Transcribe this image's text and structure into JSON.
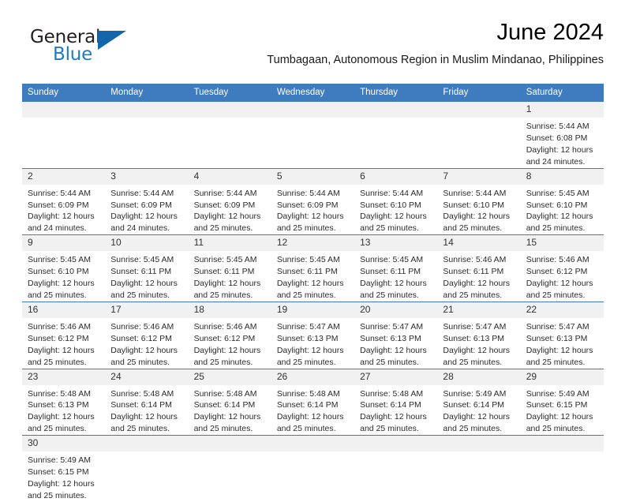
{
  "brand": {
    "name_part1": "General",
    "name_part2": "Blue",
    "primary_color": "#1466ab",
    "accent_color": "#1b7bc4"
  },
  "header": {
    "month_title": "June 2024",
    "location": "Tumbagaan, Autonomous Region in Muslim Mindanao, Philippines",
    "header_bg_color": "#3f7cbf"
  },
  "weekdays": [
    "Sunday",
    "Monday",
    "Tuesday",
    "Wednesday",
    "Thursday",
    "Friday",
    "Saturday"
  ],
  "labels": {
    "sunrise": "Sunrise:",
    "sunset": "Sunset:",
    "daylight": "Daylight:"
  },
  "weeks": [
    [
      {
        "day": "",
        "sunrise": "",
        "sunset": "",
        "daylight_line1": "",
        "daylight_line2": "",
        "blank": true
      },
      {
        "day": "",
        "sunrise": "",
        "sunset": "",
        "daylight_line1": "",
        "daylight_line2": "",
        "blank": true
      },
      {
        "day": "",
        "sunrise": "",
        "sunset": "",
        "daylight_line1": "",
        "daylight_line2": "",
        "blank": true
      },
      {
        "day": "",
        "sunrise": "",
        "sunset": "",
        "daylight_line1": "",
        "daylight_line2": "",
        "blank": true
      },
      {
        "day": "",
        "sunrise": "",
        "sunset": "",
        "daylight_line1": "",
        "daylight_line2": "",
        "blank": true
      },
      {
        "day": "",
        "sunrise": "",
        "sunset": "",
        "daylight_line1": "",
        "daylight_line2": "",
        "blank": true
      },
      {
        "day": "1",
        "sunrise": "Sunrise: 5:44 AM",
        "sunset": "Sunset: 6:08 PM",
        "daylight_line1": "Daylight: 12 hours",
        "daylight_line2": "and 24 minutes.",
        "blank": false
      }
    ],
    [
      {
        "day": "2",
        "sunrise": "Sunrise: 5:44 AM",
        "sunset": "Sunset: 6:09 PM",
        "daylight_line1": "Daylight: 12 hours",
        "daylight_line2": "and 24 minutes.",
        "blank": false
      },
      {
        "day": "3",
        "sunrise": "Sunrise: 5:44 AM",
        "sunset": "Sunset: 6:09 PM",
        "daylight_line1": "Daylight: 12 hours",
        "daylight_line2": "and 24 minutes.",
        "blank": false
      },
      {
        "day": "4",
        "sunrise": "Sunrise: 5:44 AM",
        "sunset": "Sunset: 6:09 PM",
        "daylight_line1": "Daylight: 12 hours",
        "daylight_line2": "and 25 minutes.",
        "blank": false
      },
      {
        "day": "5",
        "sunrise": "Sunrise: 5:44 AM",
        "sunset": "Sunset: 6:09 PM",
        "daylight_line1": "Daylight: 12 hours",
        "daylight_line2": "and 25 minutes.",
        "blank": false
      },
      {
        "day": "6",
        "sunrise": "Sunrise: 5:44 AM",
        "sunset": "Sunset: 6:10 PM",
        "daylight_line1": "Daylight: 12 hours",
        "daylight_line2": "and 25 minutes.",
        "blank": false
      },
      {
        "day": "7",
        "sunrise": "Sunrise: 5:44 AM",
        "sunset": "Sunset: 6:10 PM",
        "daylight_line1": "Daylight: 12 hours",
        "daylight_line2": "and 25 minutes.",
        "blank": false
      },
      {
        "day": "8",
        "sunrise": "Sunrise: 5:45 AM",
        "sunset": "Sunset: 6:10 PM",
        "daylight_line1": "Daylight: 12 hours",
        "daylight_line2": "and 25 minutes.",
        "blank": false
      }
    ],
    [
      {
        "day": "9",
        "sunrise": "Sunrise: 5:45 AM",
        "sunset": "Sunset: 6:10 PM",
        "daylight_line1": "Daylight: 12 hours",
        "daylight_line2": "and 25 minutes.",
        "blank": false
      },
      {
        "day": "10",
        "sunrise": "Sunrise: 5:45 AM",
        "sunset": "Sunset: 6:11 PM",
        "daylight_line1": "Daylight: 12 hours",
        "daylight_line2": "and 25 minutes.",
        "blank": false
      },
      {
        "day": "11",
        "sunrise": "Sunrise: 5:45 AM",
        "sunset": "Sunset: 6:11 PM",
        "daylight_line1": "Daylight: 12 hours",
        "daylight_line2": "and 25 minutes.",
        "blank": false
      },
      {
        "day": "12",
        "sunrise": "Sunrise: 5:45 AM",
        "sunset": "Sunset: 6:11 PM",
        "daylight_line1": "Daylight: 12 hours",
        "daylight_line2": "and 25 minutes.",
        "blank": false
      },
      {
        "day": "13",
        "sunrise": "Sunrise: 5:45 AM",
        "sunset": "Sunset: 6:11 PM",
        "daylight_line1": "Daylight: 12 hours",
        "daylight_line2": "and 25 minutes.",
        "blank": false
      },
      {
        "day": "14",
        "sunrise": "Sunrise: 5:46 AM",
        "sunset": "Sunset: 6:11 PM",
        "daylight_line1": "Daylight: 12 hours",
        "daylight_line2": "and 25 minutes.",
        "blank": false
      },
      {
        "day": "15",
        "sunrise": "Sunrise: 5:46 AM",
        "sunset": "Sunset: 6:12 PM",
        "daylight_line1": "Daylight: 12 hours",
        "daylight_line2": "and 25 minutes.",
        "blank": false
      }
    ],
    [
      {
        "day": "16",
        "sunrise": "Sunrise: 5:46 AM",
        "sunset": "Sunset: 6:12 PM",
        "daylight_line1": "Daylight: 12 hours",
        "daylight_line2": "and 25 minutes.",
        "blank": false
      },
      {
        "day": "17",
        "sunrise": "Sunrise: 5:46 AM",
        "sunset": "Sunset: 6:12 PM",
        "daylight_line1": "Daylight: 12 hours",
        "daylight_line2": "and 25 minutes.",
        "blank": false
      },
      {
        "day": "18",
        "sunrise": "Sunrise: 5:46 AM",
        "sunset": "Sunset: 6:12 PM",
        "daylight_line1": "Daylight: 12 hours",
        "daylight_line2": "and 25 minutes.",
        "blank": false
      },
      {
        "day": "19",
        "sunrise": "Sunrise: 5:47 AM",
        "sunset": "Sunset: 6:13 PM",
        "daylight_line1": "Daylight: 12 hours",
        "daylight_line2": "and 25 minutes.",
        "blank": false
      },
      {
        "day": "20",
        "sunrise": "Sunrise: 5:47 AM",
        "sunset": "Sunset: 6:13 PM",
        "daylight_line1": "Daylight: 12 hours",
        "daylight_line2": "and 25 minutes.",
        "blank": false
      },
      {
        "day": "21",
        "sunrise": "Sunrise: 5:47 AM",
        "sunset": "Sunset: 6:13 PM",
        "daylight_line1": "Daylight: 12 hours",
        "daylight_line2": "and 25 minutes.",
        "blank": false
      },
      {
        "day": "22",
        "sunrise": "Sunrise: 5:47 AM",
        "sunset": "Sunset: 6:13 PM",
        "daylight_line1": "Daylight: 12 hours",
        "daylight_line2": "and 25 minutes.",
        "blank": false
      }
    ],
    [
      {
        "day": "23",
        "sunrise": "Sunrise: 5:48 AM",
        "sunset": "Sunset: 6:13 PM",
        "daylight_line1": "Daylight: 12 hours",
        "daylight_line2": "and 25 minutes.",
        "blank": false
      },
      {
        "day": "24",
        "sunrise": "Sunrise: 5:48 AM",
        "sunset": "Sunset: 6:14 PM",
        "daylight_line1": "Daylight: 12 hours",
        "daylight_line2": "and 25 minutes.",
        "blank": false
      },
      {
        "day": "25",
        "sunrise": "Sunrise: 5:48 AM",
        "sunset": "Sunset: 6:14 PM",
        "daylight_line1": "Daylight: 12 hours",
        "daylight_line2": "and 25 minutes.",
        "blank": false
      },
      {
        "day": "26",
        "sunrise": "Sunrise: 5:48 AM",
        "sunset": "Sunset: 6:14 PM",
        "daylight_line1": "Daylight: 12 hours",
        "daylight_line2": "and 25 minutes.",
        "blank": false
      },
      {
        "day": "27",
        "sunrise": "Sunrise: 5:48 AM",
        "sunset": "Sunset: 6:14 PM",
        "daylight_line1": "Daylight: 12 hours",
        "daylight_line2": "and 25 minutes.",
        "blank": false
      },
      {
        "day": "28",
        "sunrise": "Sunrise: 5:49 AM",
        "sunset": "Sunset: 6:14 PM",
        "daylight_line1": "Daylight: 12 hours",
        "daylight_line2": "and 25 minutes.",
        "blank": false
      },
      {
        "day": "29",
        "sunrise": "Sunrise: 5:49 AM",
        "sunset": "Sunset: 6:15 PM",
        "daylight_line1": "Daylight: 12 hours",
        "daylight_line2": "and 25 minutes.",
        "blank": false
      }
    ],
    [
      {
        "day": "30",
        "sunrise": "Sunrise: 5:49 AM",
        "sunset": "Sunset: 6:15 PM",
        "daylight_line1": "Daylight: 12 hours",
        "daylight_line2": "and 25 minutes.",
        "blank": false
      },
      {
        "day": "",
        "sunrise": "",
        "sunset": "",
        "daylight_line1": "",
        "daylight_line2": "",
        "blank": true
      },
      {
        "day": "",
        "sunrise": "",
        "sunset": "",
        "daylight_line1": "",
        "daylight_line2": "",
        "blank": true
      },
      {
        "day": "",
        "sunrise": "",
        "sunset": "",
        "daylight_line1": "",
        "daylight_line2": "",
        "blank": true
      },
      {
        "day": "",
        "sunrise": "",
        "sunset": "",
        "daylight_line1": "",
        "daylight_line2": "",
        "blank": true
      },
      {
        "day": "",
        "sunrise": "",
        "sunset": "",
        "daylight_line1": "",
        "daylight_line2": "",
        "blank": true
      },
      {
        "day": "",
        "sunrise": "",
        "sunset": "",
        "daylight_line1": "",
        "daylight_line2": "",
        "blank": true
      }
    ]
  ]
}
